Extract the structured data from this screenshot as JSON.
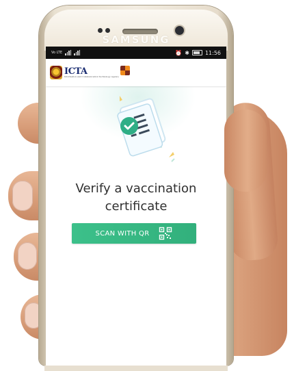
{
  "device": {
    "brand": "SAMSUNG"
  },
  "status_bar": {
    "time": "11:56",
    "left_indicators": "Vo LTE"
  },
  "app_bar": {
    "logo_text": "ICTA",
    "logo_subtext": "Information and Communication Technology Agency"
  },
  "main": {
    "title": "Verify a vaccination certificate",
    "scan_button_label": "SCAN WITH QR"
  },
  "icons": {
    "illustration": "certificate-check-icon",
    "button": "qr-code-icon"
  },
  "colors": {
    "accent": "#3cc08a",
    "check": "#2fae86",
    "status_bar": "#111111"
  }
}
